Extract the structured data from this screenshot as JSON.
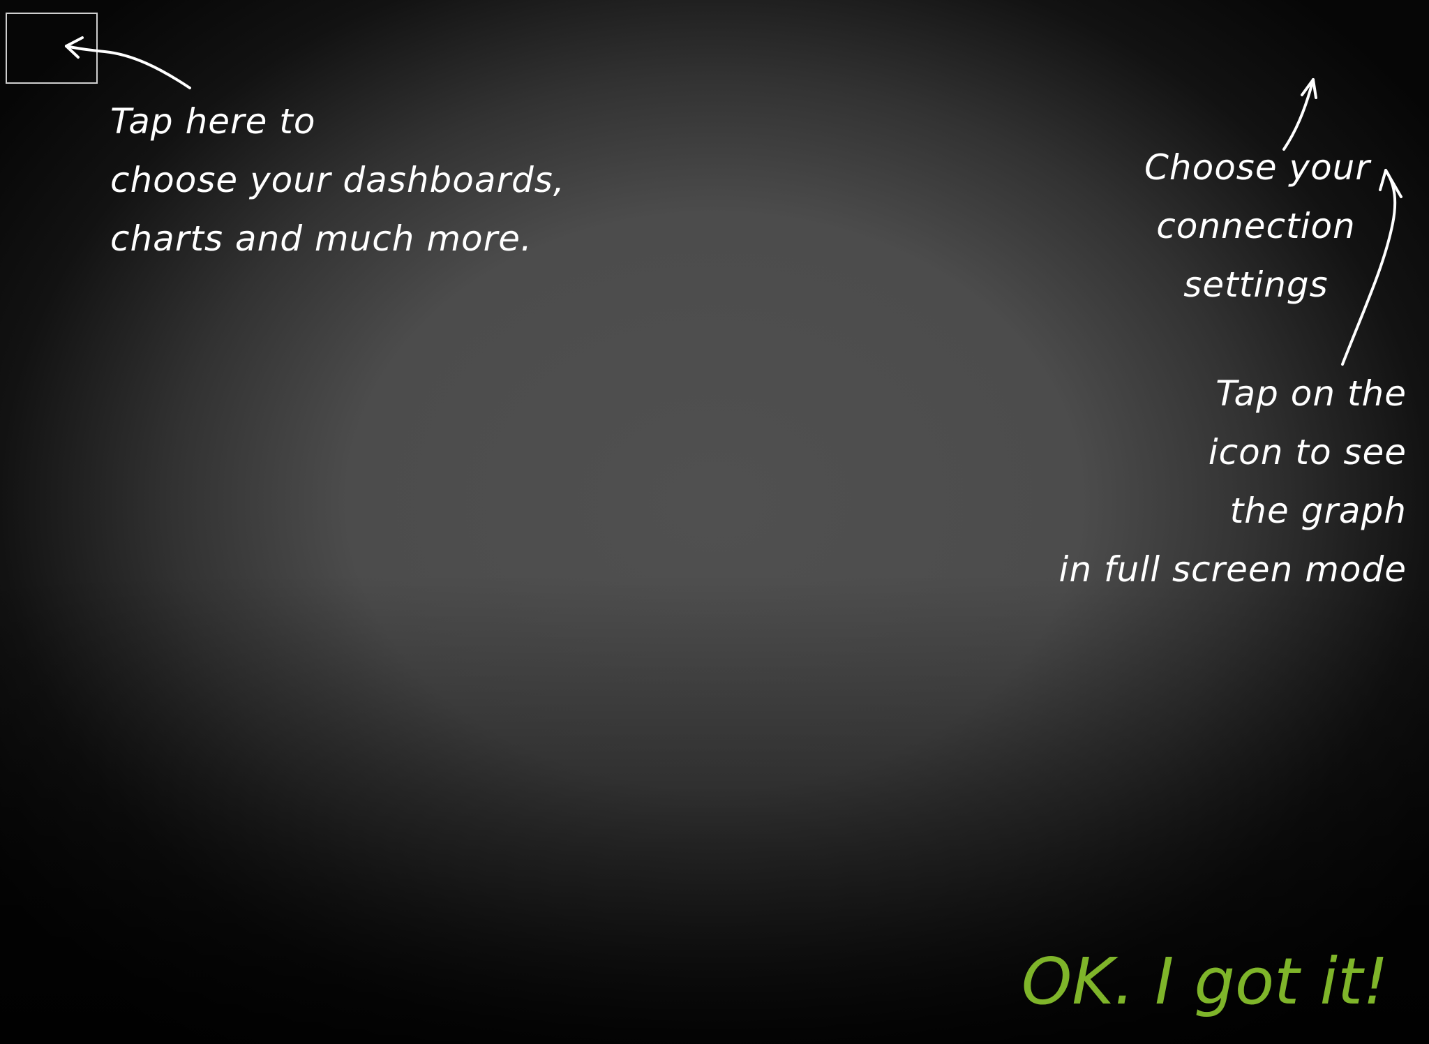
{
  "tutorial": {
    "menu_hint": {
      "lines": [
        "Tap here to",
        "choose your dashboards,",
        "charts and much more."
      ]
    },
    "connection_hint": {
      "lines": [
        "Choose your",
        "connection",
        "settings"
      ]
    },
    "fullscreen_hint": {
      "lines": [
        "Tap on the",
        "icon to see",
        "the graph",
        "in full screen mode"
      ]
    },
    "dismiss_button": "OK. I got it!"
  },
  "colors": {
    "text": "#ffffff",
    "accent": "#7fb52a",
    "background": "#4c4c4c"
  },
  "icons": {
    "menu_arrow": "arrow-left-curved",
    "connection_arrow": "arrow-up",
    "fullscreen_arrow": "arrow-up-curved"
  }
}
